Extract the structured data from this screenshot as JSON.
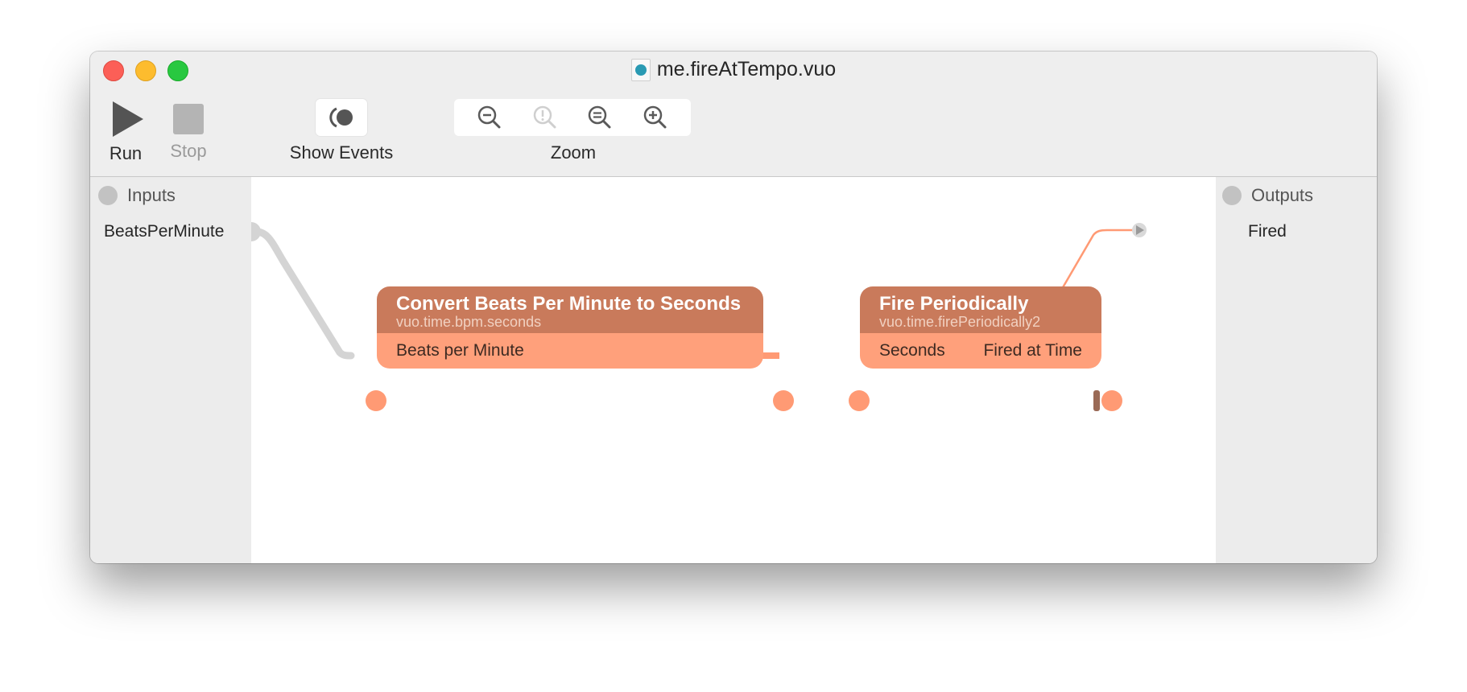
{
  "window": {
    "title": "me.fireAtTempo.vuo",
    "file_icon": "vuo-composition-icon"
  },
  "toolbar": {
    "run_label": "Run",
    "stop_label": "Stop",
    "show_events_label": "Show Events",
    "zoom_label": "Zoom",
    "zoom_buttons": [
      "zoom-out-icon",
      "zoom-actual-size-icon",
      "zoom-to-fit-icon",
      "zoom-in-icon"
    ]
  },
  "inputs_panel": {
    "title": "Inputs",
    "ports": [
      {
        "label": "BeatsPerMinute"
      }
    ]
  },
  "outputs_panel": {
    "title": "Outputs",
    "ports": [
      {
        "label": "Fired"
      }
    ]
  },
  "nodes": [
    {
      "title": "Convert Beats Per Minute to Seconds",
      "class_name": "vuo.time.bpm.seconds",
      "input_port": "Beats per Minute"
    },
    {
      "title": "Fire Periodically",
      "class_name": "vuo.time.firePeriodically2",
      "input_port": "Seconds",
      "output_port": "Fired at Time"
    }
  ],
  "colors": {
    "node_header": "#c97a5b",
    "node_body": "#ffa07b",
    "cable_data": "#ff9a74",
    "cable_published": "#d4d4d4",
    "close": "#fc5f57",
    "minimize": "#fdbc2e",
    "maximize": "#28c840"
  }
}
